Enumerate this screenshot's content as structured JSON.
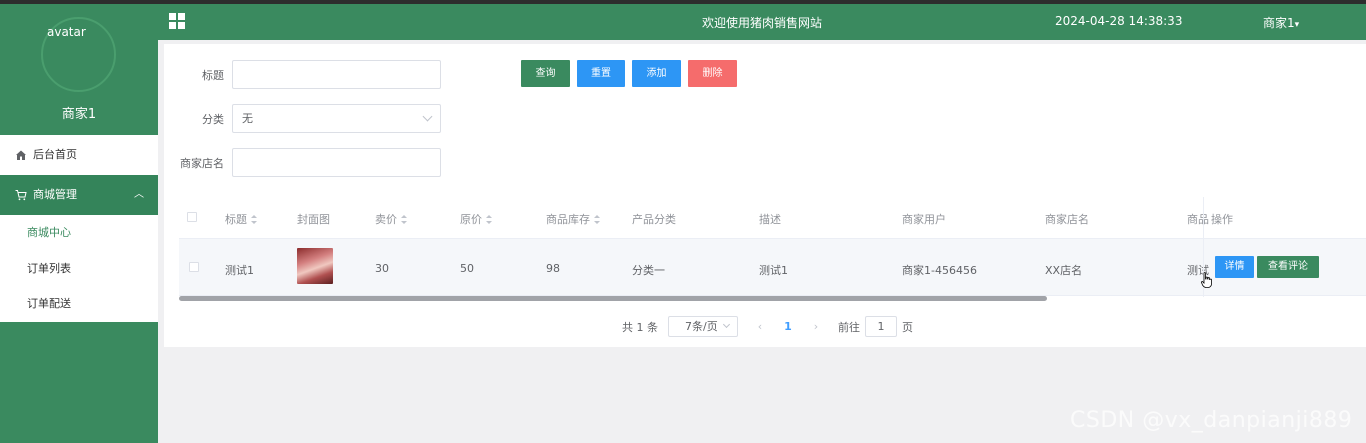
{
  "sidebar": {
    "avatar_alt": "avatar",
    "user_name": "商家1",
    "menu": {
      "home_label": "后台首页",
      "mall_label": "商城管理",
      "sub_items": [
        "商城中心",
        "订单列表",
        "订单配送"
      ]
    }
  },
  "header": {
    "welcome": "欢迎使用猪肉销售网站",
    "datetime": "2024-04-28 14:38:33",
    "user_menu": "商家1"
  },
  "filters": {
    "title_label": "标题",
    "title_value": "",
    "category_label": "分类",
    "category_value": "无",
    "shop_label": "商家店名",
    "shop_value": ""
  },
  "buttons": {
    "search": "查询",
    "reset": "重置",
    "add": "添加",
    "delete": "删除"
  },
  "table": {
    "headers": [
      "标题",
      "封面图",
      "卖价",
      "原价",
      "商品库存",
      "产品分类",
      "描述",
      "商家用户",
      "商家店名",
      "商品",
      "操作"
    ],
    "rows": [
      {
        "title": "测试1",
        "sell_price": "30",
        "original_price": "50",
        "stock": "98",
        "category": "分类一",
        "desc": "测试1",
        "merchant_user": "商家1-456456",
        "shop_name": "XX店名",
        "overflow": "测试",
        "detail_btn": "详情",
        "review_btn": "查看评论"
      }
    ]
  },
  "pagination": {
    "total": "共 1 条",
    "page_size": "7条/页",
    "prev": "‹",
    "current_page": "1",
    "next": "›",
    "goto_label": "前往",
    "goto_value": "1",
    "page_suffix": "页"
  },
  "watermark": "CSDN @vx_danpianji889",
  "colors": {
    "primary_green": "#3a8a5f",
    "blue": "#2d96f5",
    "red": "#f56c6c"
  }
}
